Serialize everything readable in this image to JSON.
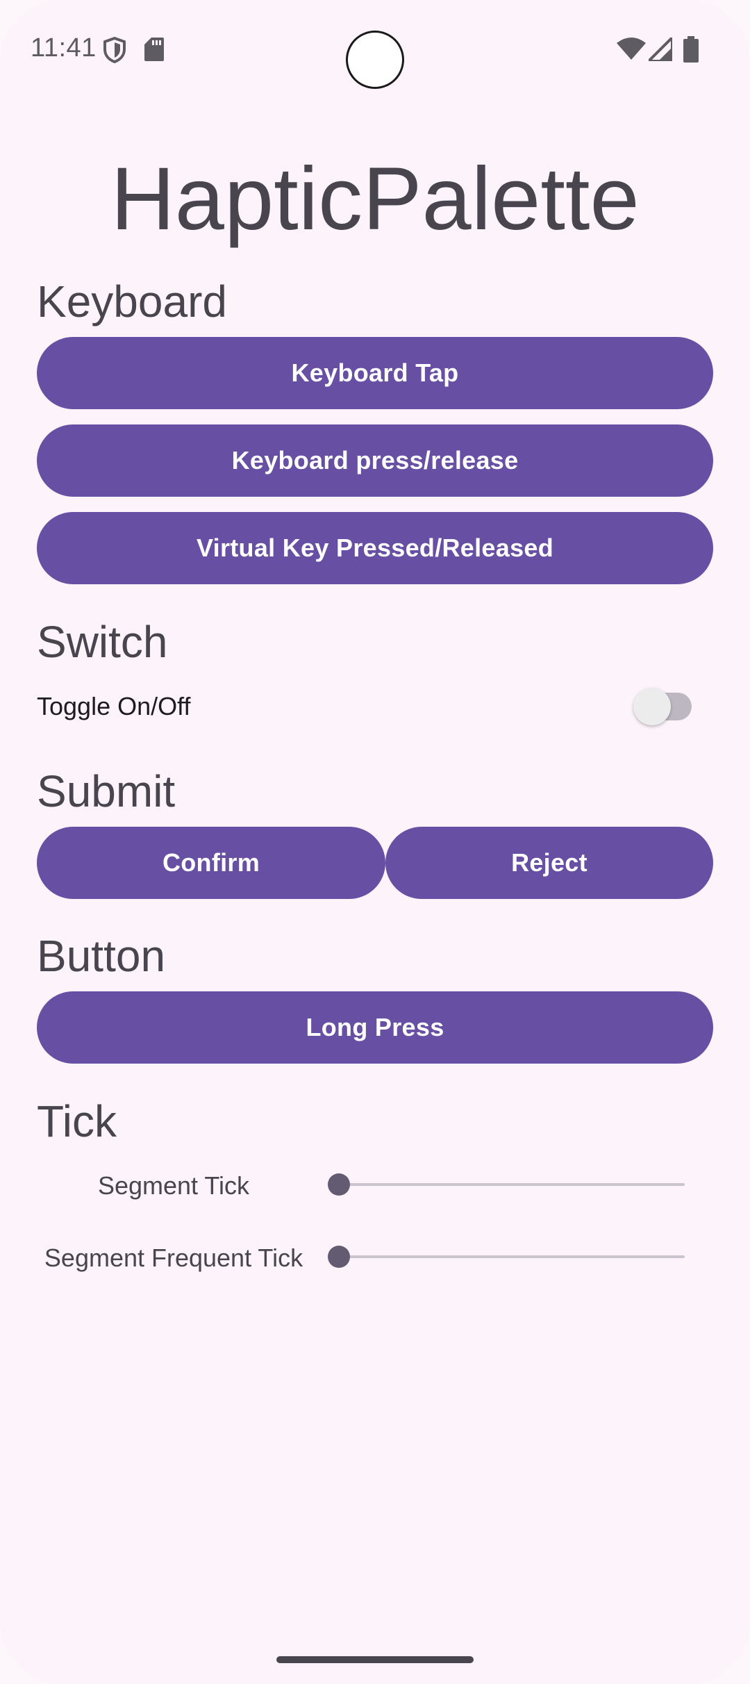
{
  "status_bar": {
    "time": "11:41",
    "icons_left": [
      "shield-icon",
      "sd-card-icon"
    ],
    "icons_right": [
      "wifi-icon",
      "cell-signal-icon",
      "battery-icon"
    ]
  },
  "app": {
    "title": "HapticPalette"
  },
  "sections": {
    "keyboard": {
      "heading": "Keyboard",
      "buttons": [
        "Keyboard Tap",
        "Keyboard press/release",
        "Virtual Key Pressed/Released"
      ]
    },
    "switch": {
      "heading": "Switch",
      "toggle_label": "Toggle On/Off",
      "toggle_on": false
    },
    "submit": {
      "heading": "Submit",
      "confirm_label": "Confirm",
      "reject_label": "Reject"
    },
    "button": {
      "heading": "Button",
      "long_press_label": "Long Press"
    },
    "tick": {
      "heading": "Tick",
      "sliders": [
        {
          "label": "Segment Tick",
          "value": 0
        },
        {
          "label": "Segment Frequent Tick",
          "value": 0
        }
      ]
    }
  },
  "colors": {
    "background": "#fcf3fb",
    "primary": "#6750a4",
    "on_primary": "#ffffff",
    "text": "#48454e"
  }
}
